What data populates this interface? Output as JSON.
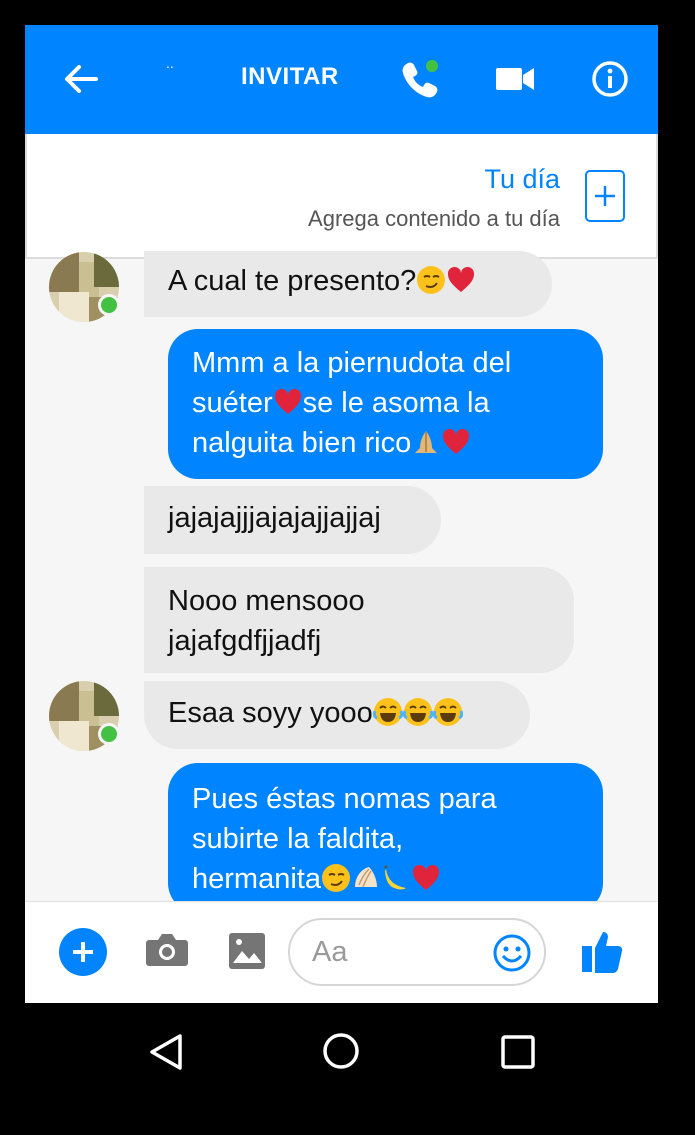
{
  "header": {
    "title": "INVITAR",
    "contact_name": "..",
    "icons": [
      "back-arrow-icon",
      "phone-icon",
      "video-camera-icon",
      "info-icon"
    ],
    "accent_color": "#0084ff"
  },
  "story": {
    "title": "Tu día",
    "subtitle": "Agrega contenido a tu día"
  },
  "messages": [
    {
      "side": "in",
      "text": "A cual te presento?",
      "emojis": [
        "smirk",
        "heart"
      ]
    },
    {
      "side": "out",
      "lines": [
        "Mmm a la piernudota del",
        "suéter",
        "se le asoma la",
        "nalguita bien rico"
      ],
      "emojis": [
        "heart",
        "praying-hands",
        "heart"
      ]
    },
    {
      "side": "in",
      "text": "jajajajjjajajajjajjaj"
    },
    {
      "side": "in",
      "lines": [
        "Nooo mensooo",
        "jajafgdfjjadfj"
      ]
    },
    {
      "side": "in",
      "text": "Esaa soyy yooo",
      "emojis": [
        "joy",
        "joy",
        "joy"
      ]
    },
    {
      "side": "out",
      "lines": [
        "Pues éstas nomas para",
        "subirte la faldita,",
        "hermanita"
      ],
      "emojis": [
        "smirk",
        "shell",
        "banana",
        "heart"
      ]
    }
  ],
  "composer": {
    "placeholder": "Aa",
    "icons": [
      "plus-icon",
      "camera-icon",
      "image-icon",
      "emoji-icon",
      "thumbs-up-icon"
    ]
  },
  "navbar": {
    "icons": [
      "back-triangle-icon",
      "home-circle-icon",
      "recents-square-icon"
    ]
  }
}
